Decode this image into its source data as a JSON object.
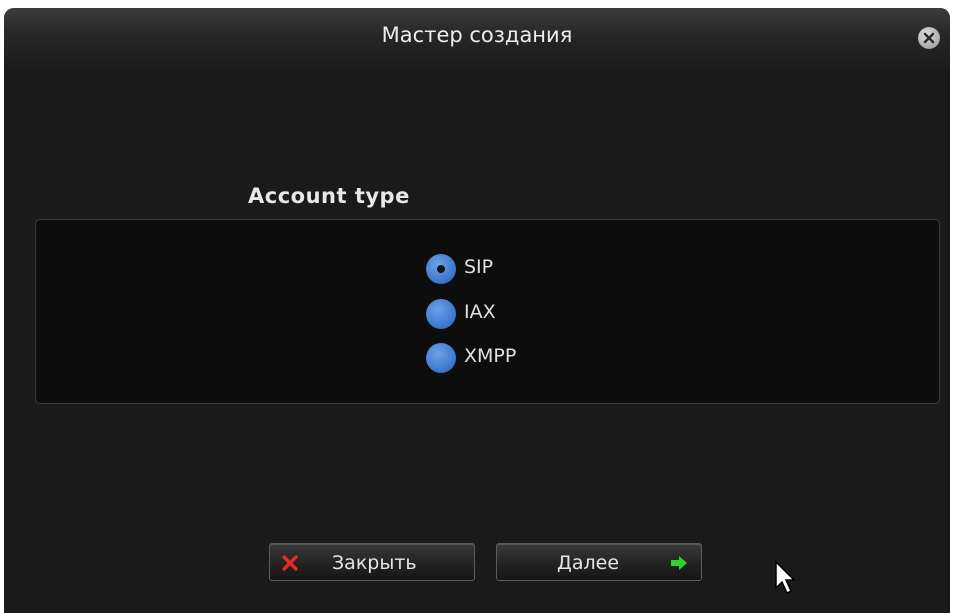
{
  "window": {
    "title": "Мастер создания",
    "close_icon": "close-icon"
  },
  "account_type": {
    "label": "Account type",
    "selected": "SIP",
    "options": [
      {
        "label": "SIP",
        "checked": true
      },
      {
        "label": "IAX",
        "checked": false
      },
      {
        "label": "XMPP",
        "checked": false
      }
    ]
  },
  "buttons": {
    "close_label": "Закрыть",
    "close_icon": "red-x-icon",
    "next_label": "Далее",
    "next_icon": "green-arrow-right-icon"
  },
  "colors": {
    "window_bg": "#1a1a1a",
    "group_bg": "#0d0d0d",
    "radio_blue": "#3f7bd0",
    "close_red": "#e8262c",
    "next_green": "#2fd12f"
  }
}
